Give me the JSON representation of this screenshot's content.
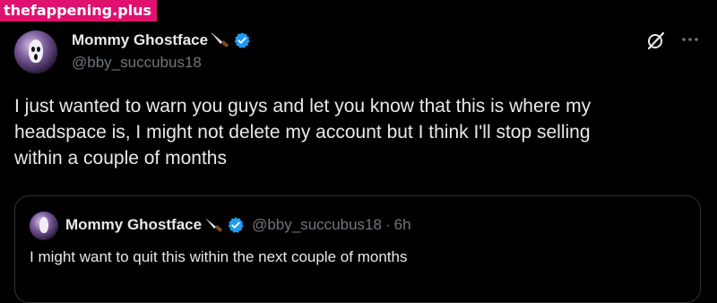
{
  "watermark": {
    "text": "thefappening.plus"
  },
  "tweet": {
    "display_name": "Mommy Ghostface",
    "handle": "@bby_succubus18",
    "text": "I just wanted to warn you guys and let you know that this is where my\nheadspace is, I might not delete my account but I think I'll stop selling\nwithin a couple of months",
    "icons": {
      "name_emoji": "knife-icon",
      "verified": "verified-icon",
      "grok": "grok-icon",
      "more": "more-icon"
    }
  },
  "quote": {
    "display_name": "Mommy Ghostface",
    "handle": "@bby_succubus18",
    "separator": "·",
    "time": "6h",
    "text": "I might want to quit this within the next couple of months"
  },
  "colors": {
    "background": "#000000",
    "primary_text": "#e7e9ea",
    "secondary_text": "#71767b",
    "verified_blue": "#1d9bf0",
    "watermark_bg": "#e0106f",
    "border": "#2f3336"
  }
}
